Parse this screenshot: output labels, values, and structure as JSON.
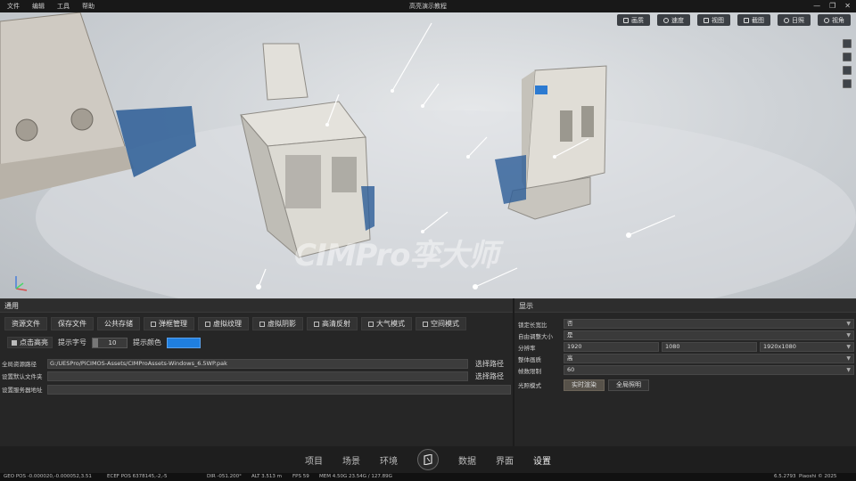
{
  "window": {
    "title": "高亮演示教程",
    "menu": [
      "文件",
      "编辑",
      "工具",
      "帮助"
    ]
  },
  "viewport": {
    "toolbar": [
      {
        "label": "画质",
        "icon": "image-quality-icon"
      },
      {
        "label": "速度",
        "icon": "speed-icon"
      },
      {
        "label": "视图",
        "icon": "view-icon"
      },
      {
        "label": "截图",
        "icon": "screenshot-icon"
      },
      {
        "label": "日照",
        "icon": "sun-icon"
      },
      {
        "label": "视角",
        "icon": "eye-icon"
      }
    ],
    "side_tools": [
      "move-tool-icon",
      "cube-tool-icon",
      "ruler-tool-icon",
      "frame-tool-icon"
    ],
    "watermark": "CIMPro孪大师"
  },
  "general_panel": {
    "title": "通用",
    "buttons": [
      {
        "label": "资源文件",
        "checkbox": false
      },
      {
        "label": "保存文件",
        "checkbox": false
      },
      {
        "label": "公共存储",
        "checkbox": false
      },
      {
        "label": "弹框管理",
        "checkbox": true,
        "checked": false
      },
      {
        "label": "虚拟纹理",
        "checkbox": true,
        "checked": false
      },
      {
        "label": "虚拟阴影",
        "checkbox": true,
        "checked": false
      },
      {
        "label": "高清反射",
        "checkbox": true,
        "checked": false
      },
      {
        "label": "大气模式",
        "checkbox": true,
        "checked": false
      },
      {
        "label": "空间模式",
        "checkbox": true,
        "checked": false
      }
    ],
    "highlight_label": "点击高亮",
    "font_size_label": "提示字号",
    "font_size_value": "10",
    "color_label": "提示颜色",
    "color_value": "#1f7fe0",
    "paths": [
      {
        "label": "全局资源路径",
        "value": "G:/UESPro/PiCIMOS-Assets/CIMProAssets-Windows_6.5WP.pak",
        "button": "选择路径"
      },
      {
        "label": "设置默认文件夹",
        "value": "",
        "button": "选择路径"
      },
      {
        "label": "设置服务器地址",
        "value": "",
        "button": ""
      }
    ]
  },
  "display_panel": {
    "title": "显示",
    "rows": [
      {
        "label": "锁定长宽比",
        "value": "否"
      },
      {
        "label": "自由调整大小",
        "value": "是"
      },
      {
        "label": "分辨率",
        "values": [
          "1920",
          "1080",
          "1920x1080"
        ]
      },
      {
        "label": "整体画质",
        "value": "高"
      },
      {
        "label": "帧数限制",
        "value": "60"
      }
    ],
    "light_mode_label": "光照模式",
    "light_modes": [
      {
        "label": "实时渲染",
        "active": true
      },
      {
        "label": "全局照明",
        "active": false
      }
    ]
  },
  "bottom_nav": {
    "items_left": [
      "项目",
      "场景",
      "环境"
    ],
    "items_right": [
      "数据",
      "界面",
      "设置"
    ],
    "active": "设置"
  },
  "status": {
    "geo_pos": "GEO POS  -0.000020,-0.000052,3.51",
    "ecef_pos": "ECEF POS  6378145,-2,-5",
    "dir": "DIR  -051.200°",
    "alt": "ALT  3.513 m",
    "fps": "FPS  59",
    "mem": "MEM  4.50G  23.54G / 127.89G",
    "version": "6.5.2793",
    "copyright": "Piaoshi © 2025"
  }
}
